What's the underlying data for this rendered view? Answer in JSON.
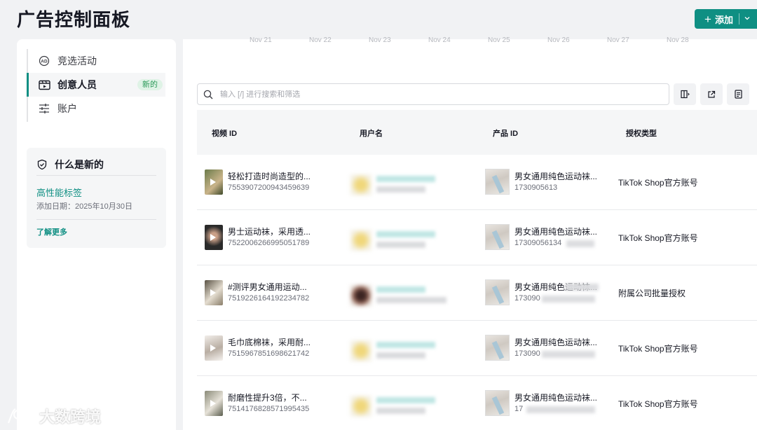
{
  "header": {
    "title": "广告控制面板",
    "add_label": "添加"
  },
  "sidebar": {
    "items": [
      {
        "label": "竞选活动",
        "icon": "ad-icon",
        "active": false
      },
      {
        "label": "创意人员",
        "icon": "creative-icon",
        "active": true,
        "badge": "新的"
      },
      {
        "label": "账户",
        "icon": "sliders-icon",
        "active": false
      }
    ],
    "whats_new": {
      "title": "什么是新的",
      "feature": "高性能标签",
      "date": "添加日期：2025年10月30日",
      "learn_more": "了解更多"
    }
  },
  "chart_axis": {
    "dates": [
      "Nov 21",
      "Nov 22",
      "Nov 23",
      "Nov 24",
      "Nov 25",
      "Nov 26",
      "Nov 27",
      "Nov 28"
    ]
  },
  "search": {
    "placeholder": "输入 [/] 进行搜索和筛选"
  },
  "table": {
    "columns": [
      "视频 ID",
      "用户名",
      "产品 ID",
      "授权类型"
    ],
    "rows": [
      {
        "video_title": "轻松打造时尚造型的...",
        "video_id": "7553907200943459639",
        "product_title": "男女通用纯色运动袜...",
        "product_id": "1730905613",
        "auth": "TikTok Shop官方账号"
      },
      {
        "video_title": "男士运动袜，采用透...",
        "video_id": "7522006266995051789",
        "product_title": "男女通用纯色运动袜...",
        "product_id": "17309056134",
        "auth": "TikTok Shop官方账号"
      },
      {
        "video_title": "#测评男女通用运动...",
        "video_id": "7519226164192234782",
        "product_title": "男女通用纯色运动袜...",
        "product_id": "173090",
        "auth": "附属公司批量授权"
      },
      {
        "video_title": "毛巾底棉袜，采用耐...",
        "video_id": "7515967851698621742",
        "product_title": "男女通用纯色运动袜...",
        "product_id": "173090",
        "auth": "TikTok Shop官方账号"
      },
      {
        "video_title": "耐磨性提升3倍，不...",
        "video_id": "7514176828571995435",
        "product_title": "男女通用纯色运动袜...",
        "product_id": "17",
        "auth": "TikTok Shop官方账号"
      }
    ]
  },
  "watermark": {
    "text": "大数跨境"
  }
}
